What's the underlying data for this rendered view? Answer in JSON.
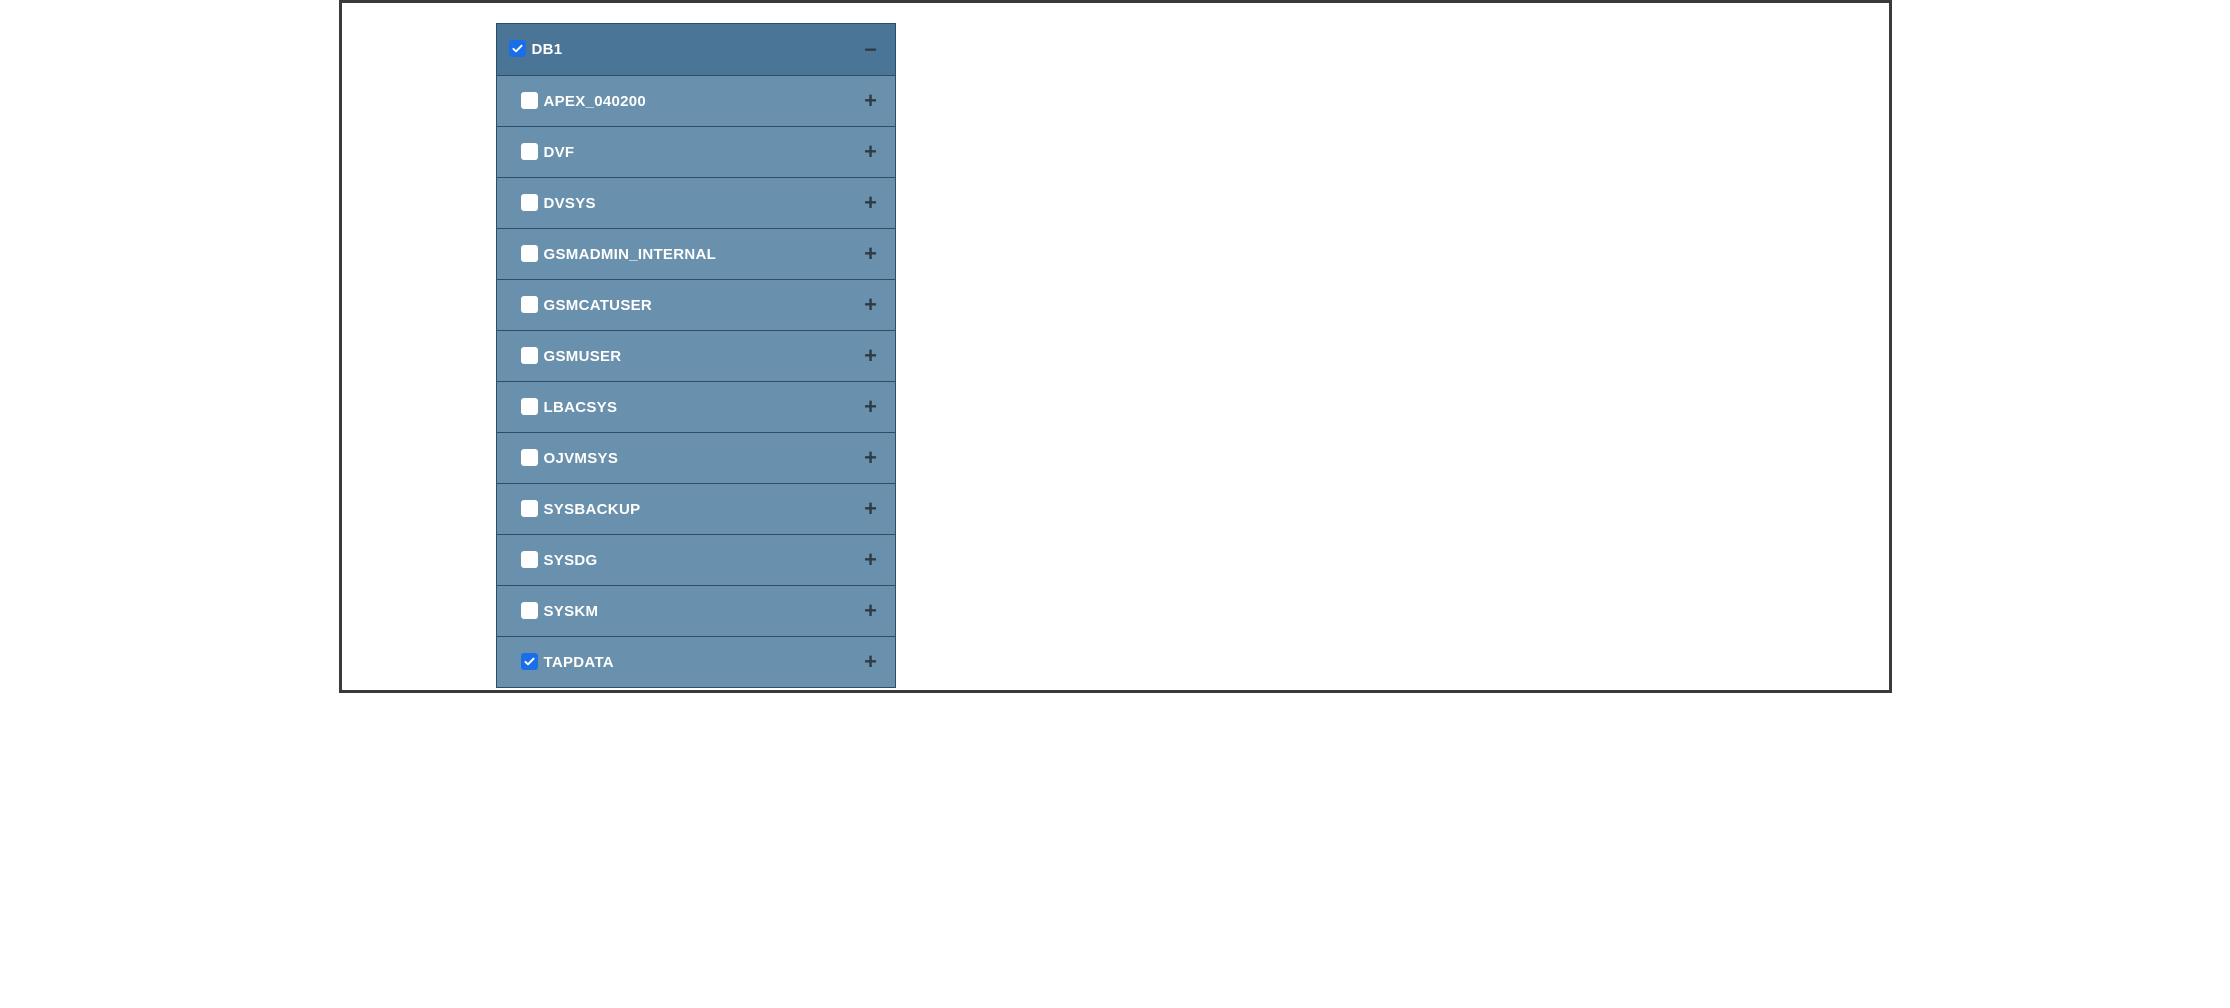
{
  "tree": {
    "root": {
      "label": "DB1",
      "checked": true,
      "expanded": true
    },
    "children": [
      {
        "label": "APEX_040200",
        "checked": false,
        "expanded": false
      },
      {
        "label": "DVF",
        "checked": false,
        "expanded": false
      },
      {
        "label": "DVSYS",
        "checked": false,
        "expanded": false
      },
      {
        "label": "GSMADMIN_INTERNAL",
        "checked": false,
        "expanded": false
      },
      {
        "label": "GSMCATUSER",
        "checked": false,
        "expanded": false
      },
      {
        "label": "GSMUSER",
        "checked": false,
        "expanded": false
      },
      {
        "label": "LBACSYS",
        "checked": false,
        "expanded": false
      },
      {
        "label": "OJVMSYS",
        "checked": false,
        "expanded": false
      },
      {
        "label": "SYSBACKUP",
        "checked": false,
        "expanded": false
      },
      {
        "label": "SYSDG",
        "checked": false,
        "expanded": false
      },
      {
        "label": "SYSKM",
        "checked": false,
        "expanded": false
      },
      {
        "label": "TAPDATA",
        "checked": true,
        "expanded": false
      }
    ]
  },
  "icons": {
    "plus": "+",
    "minus": "−"
  }
}
